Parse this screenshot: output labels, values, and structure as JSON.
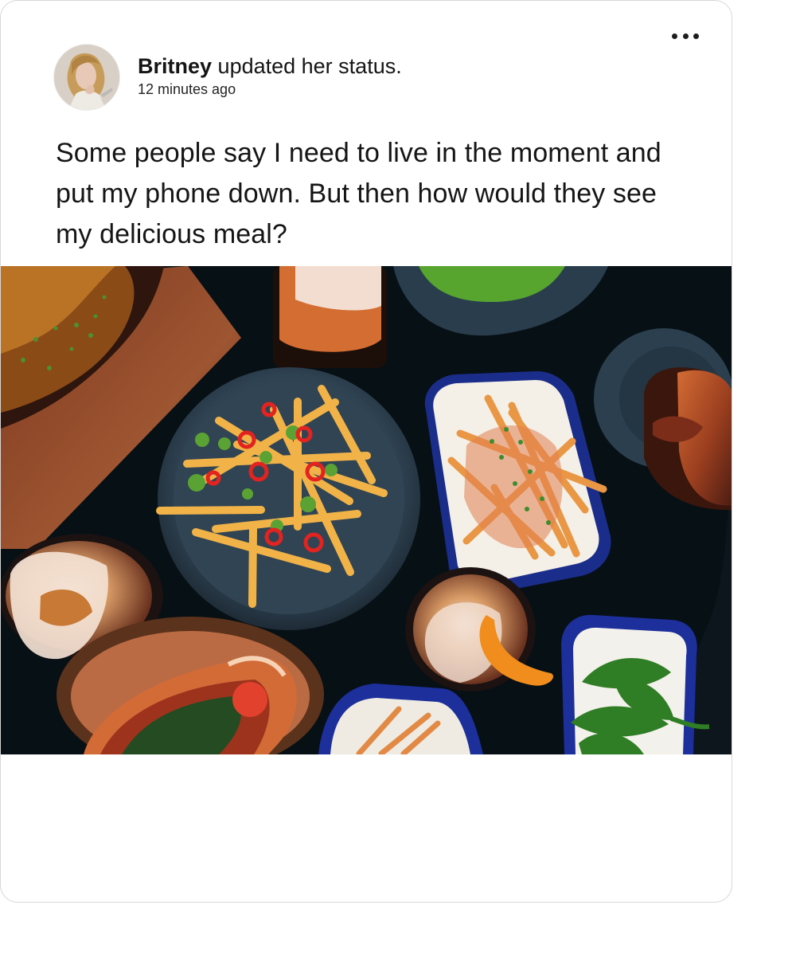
{
  "post": {
    "author": {
      "name": "Britney",
      "avatar": "woman-with-long-blonde-hair-avatar"
    },
    "status_action": "updated her status.",
    "timestamp": "12 minutes ago",
    "text": "Some people say I need to live in the moment and put my phone down. But then how would they see my delicious meal?",
    "photo": {
      "subject": "overhead-table-of-food-image",
      "items": [
        "ribs",
        "fries-with-peppers",
        "loaded-fries",
        "burger",
        "drinks",
        "hot-dog",
        "green-peppers"
      ]
    },
    "more_icon": "horizontal-ellipsis-icon"
  },
  "colors": {
    "card_border": "#d7d7d7",
    "text": "#151515",
    "table": "#071015",
    "plate": "#314453",
    "bowl_rim": "#1c2f9a"
  }
}
